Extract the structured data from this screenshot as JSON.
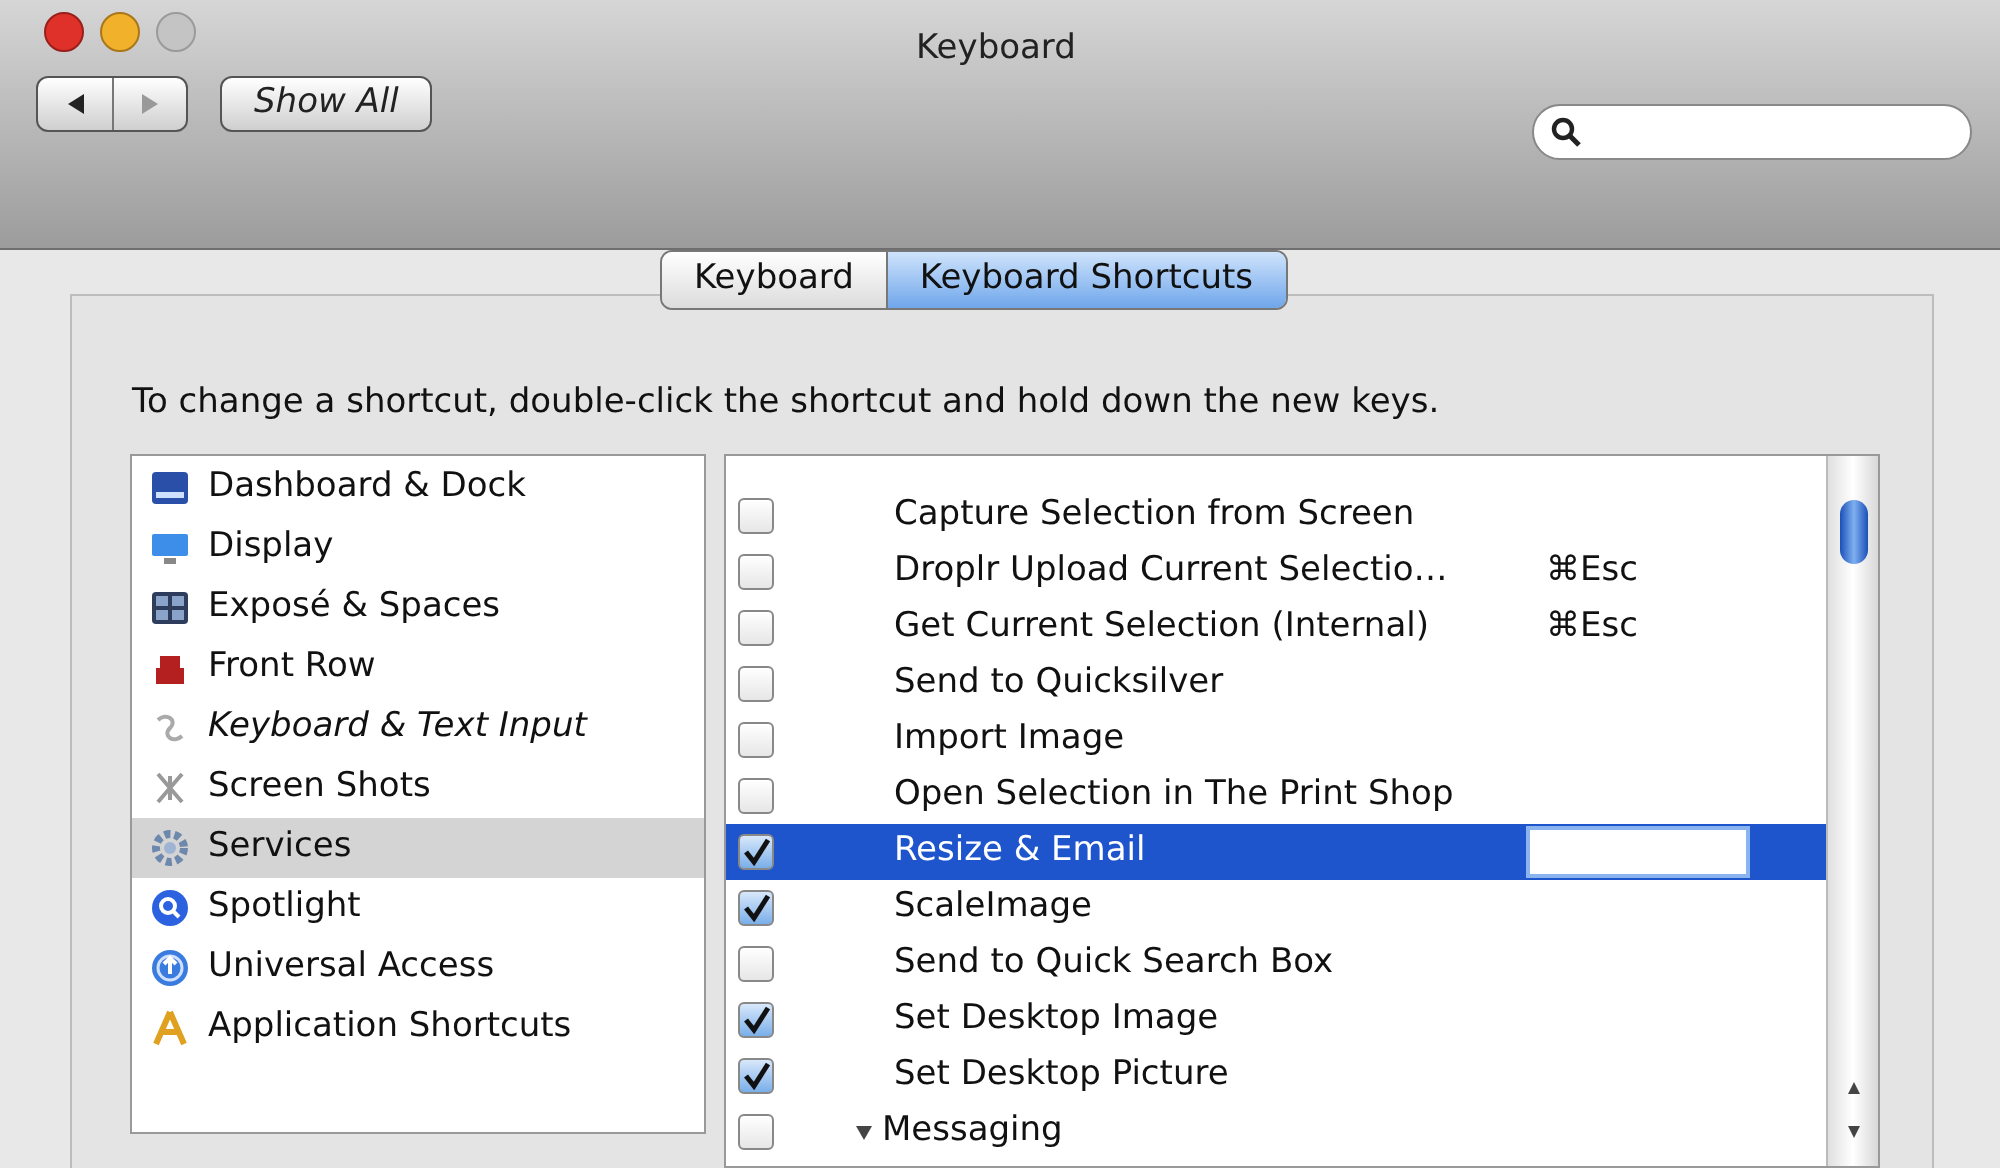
{
  "window": {
    "title": "Keyboard"
  },
  "toolbar": {
    "show_all": "Show All"
  },
  "tabs": [
    {
      "label": "Keyboard",
      "selected": false
    },
    {
      "label": "Keyboard Shortcuts",
      "selected": true
    }
  ],
  "instructions": "To change a shortcut, double-click the shortcut and hold down the new keys.",
  "categories": [
    {
      "label": "Dashboard & Dock",
      "selected": false
    },
    {
      "label": "Display",
      "selected": false
    },
    {
      "label": "Exposé & Spaces",
      "selected": false
    },
    {
      "label": "Front Row",
      "selected": false
    },
    {
      "label": "Keyboard & Text Input",
      "selected": false
    },
    {
      "label": "Screen Shots",
      "selected": false
    },
    {
      "label": "Services",
      "selected": true
    },
    {
      "label": "Spotlight",
      "selected": false
    },
    {
      "label": "Universal Access",
      "selected": false
    },
    {
      "label": "Application Shortcuts",
      "selected": false
    }
  ],
  "shortcuts": [
    {
      "kind": "service",
      "label": "Capture Selection from Screen",
      "checked": false,
      "selected": false
    },
    {
      "kind": "service",
      "label": "Droplr Upload Current Selectio…",
      "shortcut": "⌘Esc",
      "checked": false,
      "selected": false
    },
    {
      "kind": "service",
      "label": "Get Current Selection (Internal)",
      "shortcut": "⌘Esc",
      "checked": false,
      "selected": false
    },
    {
      "kind": "service",
      "label": "Send to Quicksilver",
      "checked": false,
      "selected": false
    },
    {
      "kind": "service",
      "label": "Import Image",
      "checked": false,
      "selected": false
    },
    {
      "kind": "service",
      "label": "Open Selection in The Print Shop",
      "checked": false,
      "selected": false
    },
    {
      "kind": "service",
      "label": "Resize & Email",
      "checked": true,
      "selected": true
    },
    {
      "kind": "service",
      "label": "ScaleImage",
      "checked": true,
      "selected": false
    },
    {
      "kind": "service",
      "label": "Send to Quick Search Box",
      "checked": false,
      "selected": false
    },
    {
      "kind": "service",
      "label": "Set Desktop Image",
      "checked": true,
      "selected": false
    },
    {
      "kind": "service",
      "label": "Set Desktop Picture",
      "checked": true,
      "selected": false
    },
    {
      "kind": "group",
      "label": "Messaging",
      "checked": false,
      "selected": false
    }
  ]
}
